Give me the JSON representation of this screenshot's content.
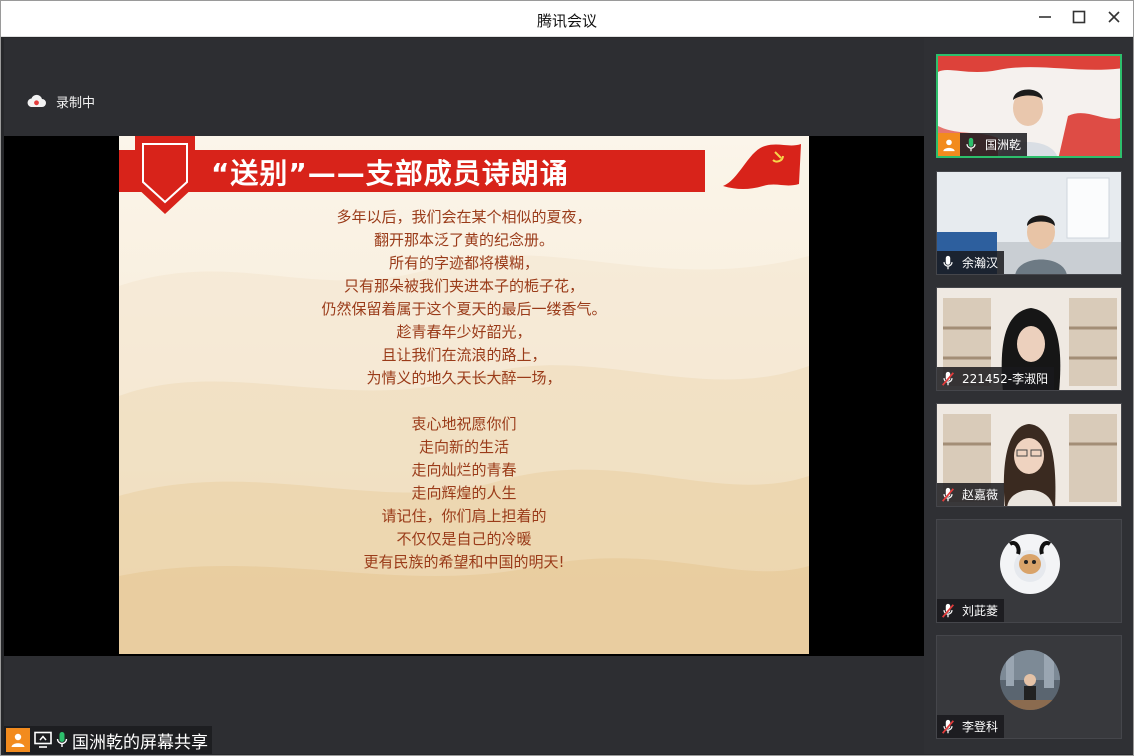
{
  "window": {
    "title": "腾讯会议"
  },
  "recording": {
    "label": "录制中",
    "icon": "cloud-record-icon"
  },
  "slide": {
    "title": "“送别”——支部成员诗朗诵",
    "poem": [
      "多年以后，我们会在某个相似的夏夜，",
      "翻开那本泛了黄的纪念册。",
      "所有的字迹都将模糊，",
      "只有那朵被我们夹进本子的栀子花，",
      "仍然保留着属于这个夏天的最后一缕香气。",
      "趁青春年少好韶光，",
      "且让我们在流浪的路上，",
      "为情义的地久天长大醉一场，",
      "",
      "衷心地祝愿你们",
      "走向新的生活",
      "走向灿烂的青春",
      "走向辉煌的人生",
      "请记住，你们肩上担着的",
      "不仅仅是自己的冷暖",
      "更有民族的希望和中国的明天!"
    ]
  },
  "share": {
    "label": "国洲乾的屏幕共享"
  },
  "participants": [
    {
      "name": "国洲乾",
      "mic": "on",
      "host": true,
      "video": "red-stage"
    },
    {
      "name": "余瀚汉",
      "mic": "on",
      "host": false,
      "video": "office"
    },
    {
      "name": "221452-李淑阳",
      "mic": "muted",
      "host": false,
      "video": "bookshelf-dark-hair"
    },
    {
      "name": "赵嘉薇",
      "mic": "muted",
      "host": false,
      "video": "bookshelf-glasses"
    },
    {
      "name": "刘茈菱",
      "mic": "muted",
      "host": false,
      "video": "avatar-dog"
    },
    {
      "name": "李登科",
      "mic": "muted",
      "host": false,
      "video": "avatar-city"
    }
  ],
  "colors": {
    "accent": "#2dbf6c",
    "host": "#f28b1e",
    "title_red": "#d8231a",
    "poem": "#9a3b19"
  }
}
